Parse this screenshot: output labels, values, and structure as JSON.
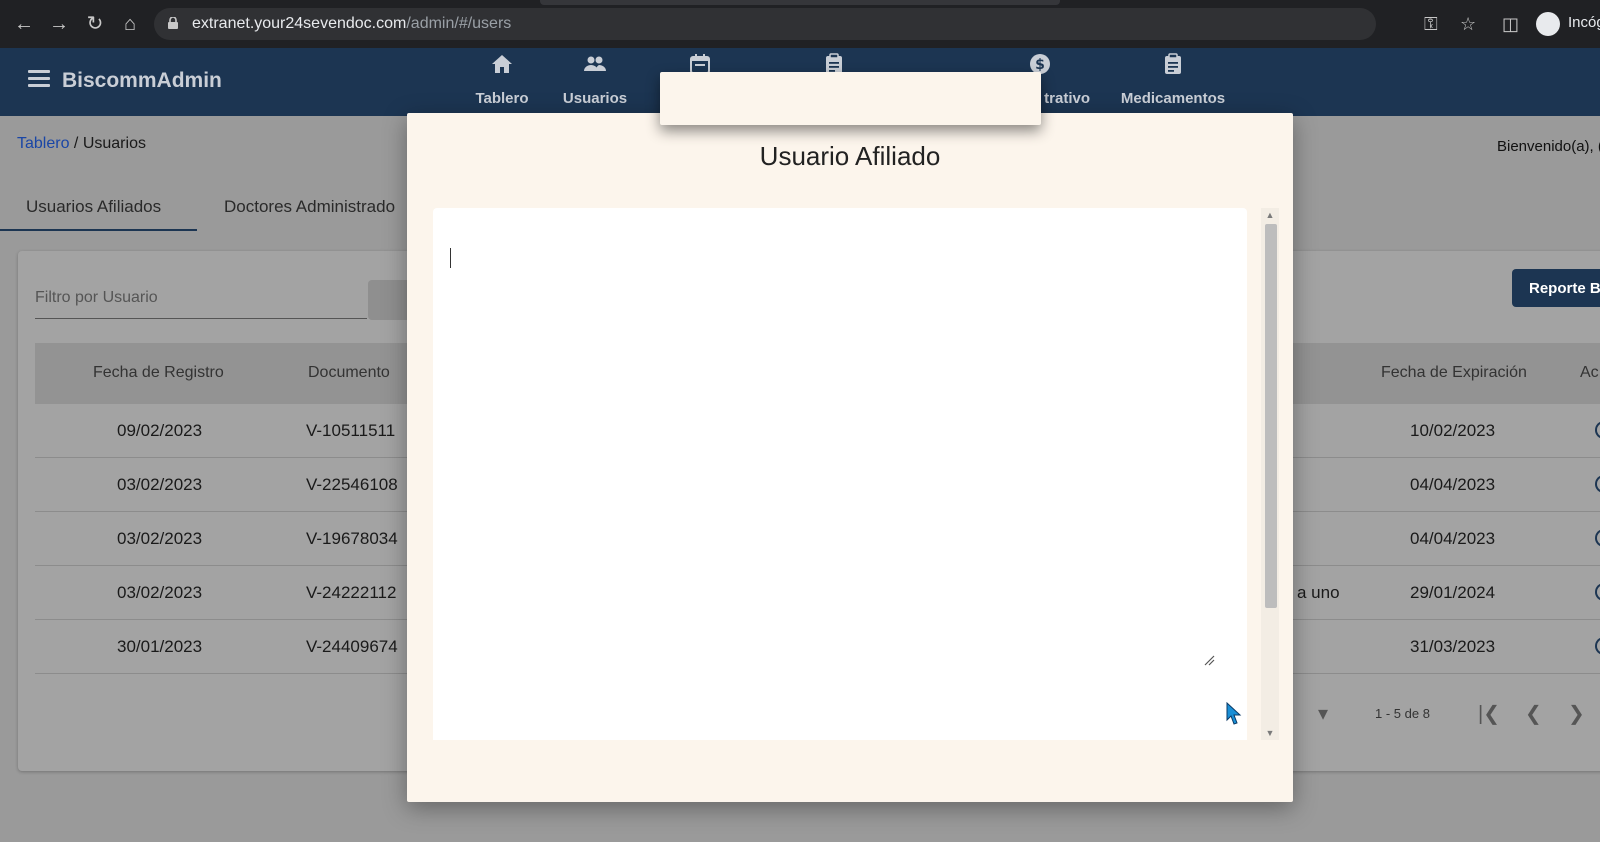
{
  "browser": {
    "url_host": "extranet.your24sevendoc.com",
    "url_path": "/admin/#/users",
    "profile_label": "Incóg"
  },
  "app": {
    "brand": "BiscommAdmin",
    "nav": [
      {
        "label": "Tablero",
        "icon": "home-icon"
      },
      {
        "label": "Usuarios",
        "icon": "people-icon"
      },
      {
        "label": "",
        "icon": "calendar-icon"
      },
      {
        "label": "",
        "icon": "clipboard-icon"
      },
      {
        "label": "trativo",
        "icon": "dollar-icon"
      },
      {
        "label": "Medicamentos",
        "icon": "clipboard-icon"
      }
    ]
  },
  "breadcrumb": {
    "home": "Tablero",
    "separator": " / ",
    "current": "Usuarios"
  },
  "welcome": "Bienvenido(a), (",
  "tabs": [
    {
      "label": "Usuarios Afiliados",
      "active": true
    },
    {
      "label": "Doctores Administrado",
      "active": false
    }
  ],
  "filter": {
    "placeholder": "Filtro por Usuario"
  },
  "report_button": "Reporte Bi",
  "table": {
    "headers": [
      "Fecha de Registro",
      "Documento",
      "Fecha de Expiración",
      "Ac"
    ],
    "rows": [
      {
        "registro": "09/02/2023",
        "documento": "V-10511511",
        "extra": "",
        "expiracion": "10/02/2023"
      },
      {
        "registro": "03/02/2023",
        "documento": "V-22546108",
        "extra": "",
        "expiracion": "04/04/2023"
      },
      {
        "registro": "03/02/2023",
        "documento": "V-19678034",
        "extra": "",
        "expiracion": "04/04/2023"
      },
      {
        "registro": "03/02/2023",
        "documento": "V-24222112",
        "extra": "a uno",
        "expiracion": "29/01/2024"
      },
      {
        "registro": "30/01/2023",
        "documento": "V-24409674",
        "extra": "",
        "expiracion": "31/03/2023"
      }
    ]
  },
  "pager": {
    "range": "1 - 5 de 8"
  },
  "modal": {
    "title": "Usuario Afiliado",
    "editor_value": ""
  },
  "colors": {
    "header": "#1c3552",
    "modal_bg": "#fcf5ec",
    "link": "#1a46a6"
  }
}
